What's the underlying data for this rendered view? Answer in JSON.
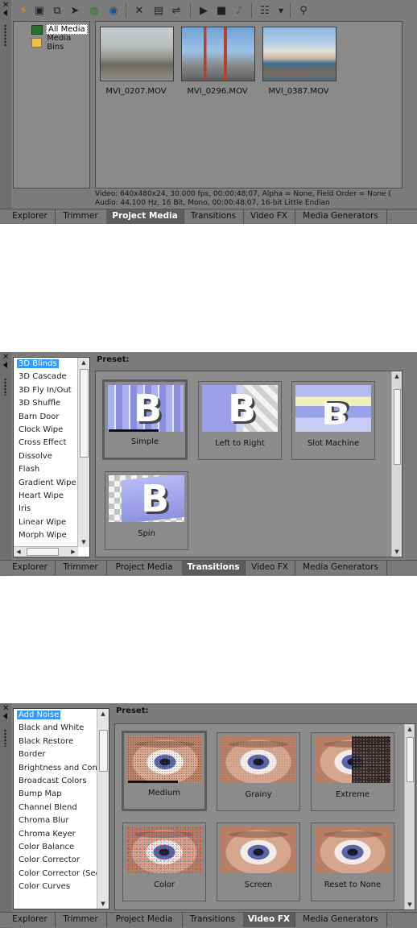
{
  "panel1": {
    "tree": [
      {
        "label": "All Media",
        "selected": true,
        "icon": "media-icon"
      },
      {
        "label": "Media Bins",
        "selected": false,
        "icon": "folder-icon"
      }
    ],
    "thumbnails": [
      {
        "caption": "MVI_0207.MOV",
        "scene": "foggy-coast"
      },
      {
        "caption": "MVI_0296.MOV",
        "scene": "golden-gate-bridge"
      },
      {
        "caption": "MVI_0387.MOV",
        "scene": "pier-sea-lions"
      }
    ],
    "info_video": "Video: 640x480x24, 30.000 fps, 00:00:48;07, Alpha = None, Field Order = None (",
    "info_audio": "Audio: 44,100 Hz, 16 Bit, Mono, 00:00:48;07, 16-bit Little Endian",
    "toolbar_icons": [
      "import-media-icon",
      "capture-video-icon",
      "get-photo-icon",
      "extract-audio-icon",
      "media-fx-icon",
      "web-icon",
      "delete-icon",
      "properties-icon",
      "tagging-icon",
      "play-icon",
      "stop-icon",
      "auto-preview-icon",
      "views-icon",
      "dropdown-icon",
      "search-icon"
    ]
  },
  "panel2": {
    "preset_label": "Preset:",
    "list": [
      "3D Blinds",
      "3D Cascade",
      "3D Fly In/Out",
      "3D Shuffle",
      "Barn Door",
      "Clock Wipe",
      "Cross Effect",
      "Dissolve",
      "Flash",
      "Gradient Wipe",
      "Heart Wipe",
      "Iris",
      "Linear Wipe",
      "Morph Wipe"
    ],
    "selected_index": 0,
    "presets": [
      "Simple",
      "Left to Right",
      "Slot Machine",
      "Spin"
    ],
    "selected_preset": 0
  },
  "panel3": {
    "preset_label": "Preset:",
    "list": [
      "Add Noise",
      "Black and White",
      "Black Restore",
      "Border",
      "Brightness and Cont",
      "Broadcast Colors",
      "Bump Map",
      "Channel Blend",
      "Chroma Blur",
      "Chroma Keyer",
      "Color Balance",
      "Color Corrector",
      "Color Corrector (Sec",
      "Color Curves"
    ],
    "selected_index": 0,
    "presets": [
      "Medium",
      "Grainy",
      "Extreme",
      "Color",
      "Screen",
      "Reset to None"
    ],
    "selected_preset": 0
  },
  "tabs": [
    "Explorer",
    "Trimmer",
    "Project Media",
    "Transitions",
    "Video FX",
    "Media Generators"
  ],
  "active_tabs": {
    "panel1": 2,
    "panel2": 3,
    "panel3": 4
  }
}
